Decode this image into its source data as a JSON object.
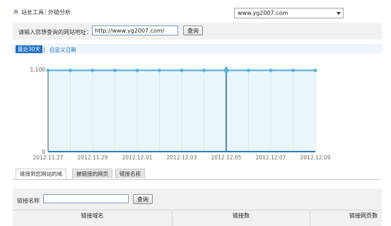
{
  "breadcrumb": {
    "tool": "站长工具",
    "current": "外链分析"
  },
  "site_select": {
    "value": "www.yg2007.com"
  },
  "url_query": {
    "label": "请输入您想查询的网站地址：",
    "value": "http://www.yg2007.com/",
    "button": "查询"
  },
  "range": {
    "active": "最近30天",
    "separator": "|",
    "custom": "自定义日期"
  },
  "colors": {
    "accent": "#1b6fc3",
    "line": "#5ab4de",
    "area": "#e9f6fd"
  },
  "chart_data": {
    "type": "area",
    "x": [
      "2012.11.27",
      "2012.11.28",
      "2012.11.29",
      "2012.11.30",
      "2012.12.01",
      "2012.12.02",
      "2012.12.03",
      "2012.12.04",
      "2012.12.05",
      "2012.12.06",
      "2012.12.07",
      "2012.12.08",
      "2012.12.09"
    ],
    "x_tick_labels": [
      "2012.11.27",
      "2012.11.29",
      "2012.12.01",
      "2012.12.03",
      "2012.12.05",
      "2012.12.07",
      "2012.12.09"
    ],
    "values": [
      1087,
      1087,
      1087,
      1087,
      1087,
      1087,
      1087,
      1087,
      1087,
      1087,
      1087,
      1087,
      1087
    ],
    "y_tick_labels": [
      "1,100",
      "0"
    ],
    "ylim": [
      0,
      1100
    ],
    "highlight_index": 8,
    "grid": true
  },
  "tabs": [
    {
      "label": "链接到您网站的域",
      "active": true
    },
    {
      "label": "被链接的网页",
      "active": false
    },
    {
      "label": "链接名称",
      "active": false
    }
  ],
  "filter": {
    "label": "链接名称",
    "value": "",
    "button": "查询"
  },
  "table": {
    "headers": [
      "链接域名",
      "链接数",
      "链接网页数"
    ]
  }
}
